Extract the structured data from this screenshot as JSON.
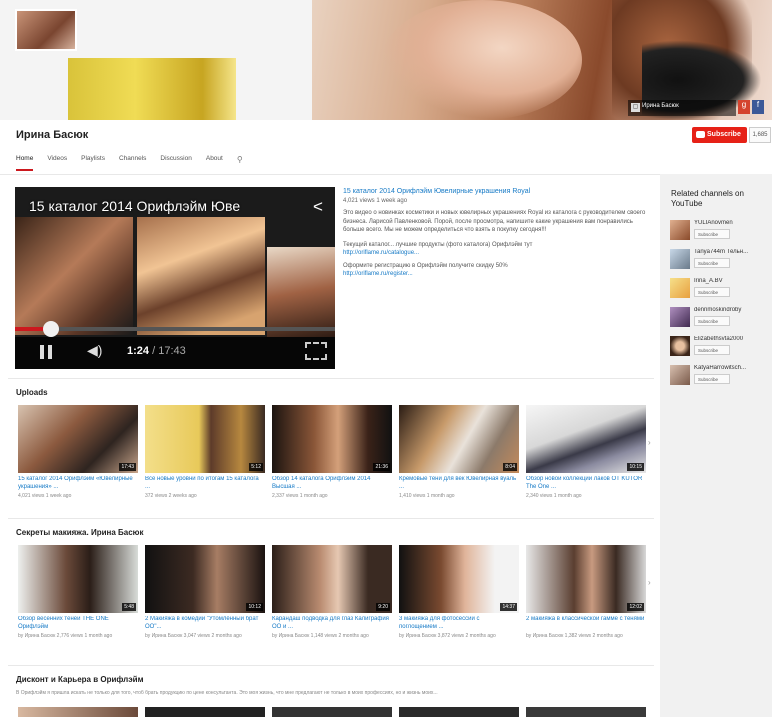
{
  "channel": {
    "name": "Ирина Басюк",
    "subscribe_label": "Subscribe",
    "subscriber_count": "1,685",
    "banner_links_label": "Ирина Басюк"
  },
  "tabs": [
    "Home",
    "Videos",
    "Playlists",
    "Channels",
    "Discussion",
    "About"
  ],
  "featured": {
    "title_overlay": "15 каталог 2014 Орифлэйм Юве",
    "time_current": "1:24",
    "time_duration": "/ 17:43",
    "progress_fraction": 0.11,
    "link_title": "15 каталог 2014 Орифлэйм Ювелирные украшения Royal",
    "meta": "4,021 views  1 week ago",
    "description": "Это видео о новинках косметики и новых ювелирных украшениях Royal из каталога с руководителем своего бизнеса. Ларисой Павленковой. Порой, после просмотра, напишите какие украшения вам понравились больше всего. Мы не можем определиться что взять в покупку сегодня!!!",
    "cta_line1": "Текущий каталог... лучшие продукты (фото каталога) Орифлэйм тут",
    "link1": "http://oriflame.ru/catalogue...",
    "cta_line2": "Оформите регистрацию в Орифлэйм получите скидку 50%",
    "link2": "http://oriflame.ru/register..."
  },
  "sections": [
    {
      "title": "Uploads",
      "videos": [
        {
          "title": "15 каталог 2014 Орифлэйм «Ювелирные украшения» ...",
          "meta": "4,021 views  1 week ago",
          "duration": "17:43"
        },
        {
          "title": "Все новые уровни по итогам 15 каталога ...",
          "meta": "372 views  2 weeks ago",
          "duration": "5:12"
        },
        {
          "title": "Обзор 14 каталога Орифлэйм 2014 Высшая ...",
          "meta": "2,337 views  1 month ago",
          "duration": "21:36"
        },
        {
          "title": "Кремовые тени для век Ювелирная вуаль ...",
          "meta": "1,410 views  1 month ago",
          "duration": "8:04"
        },
        {
          "title": "Обзор новой коллекции лаков OT KUTOR The One ...",
          "meta": "2,340 views  1 month ago",
          "duration": "10:15"
        }
      ]
    },
    {
      "title": "Секреты макияжа. Ирина Басюк",
      "videos": [
        {
          "title": "Обзор весенних теней THE ONE Орифлэйм",
          "meta": "by Ирина Басюк  2,776 views  1 month ago",
          "duration": "5:48"
        },
        {
          "title": "2 Макияжа в комедии \"Утомлённый брат ОО\"...",
          "meta": "by Ирина Басюк  3,047 views  2 months ago",
          "duration": "10:12"
        },
        {
          "title": "Карандаш подводка для глаз Калиграфия OO и ...",
          "meta": "by Ирина Басюк  1,148 views  2 months ago",
          "duration": "9:20"
        },
        {
          "title": "3 макияжа для фотосессии с поглощением ...",
          "meta": "by Ирина Басюк  3,872 views  2 months ago",
          "duration": "14:37"
        },
        {
          "title": "2 макияжа в классической гамме с тенями",
          "meta": "by Ирина Басюк  1,382 views  2 months ago",
          "duration": "12:02"
        }
      ]
    },
    {
      "title": "Дисконт и Карьера в Орифлэйм",
      "description": "В Орифлэйм я пришла искать не только для того, чтоб брать продукцию по цене консультанта. Это моя жизнь, что мне предлагают не только в моих профессиях, но и жизнь моих..."
    }
  ],
  "related": {
    "title": "Related channels on YouTube",
    "subscribe_label": "Subscribe",
    "channels": [
      {
        "name": "YULIAnovmen"
      },
      {
        "name": "Tanya744m Тельн..."
      },
      {
        "name": "Irina_A.BV"
      },
      {
        "name": "dennmoskindroby"
      },
      {
        "name": "Elizabethsvta2000"
      },
      {
        "name": "KatyaHarrowitsch..."
      }
    ]
  },
  "colors": {
    "accent": "#cc181e",
    "link": "#167ac6",
    "subscribe": "#e62117"
  }
}
